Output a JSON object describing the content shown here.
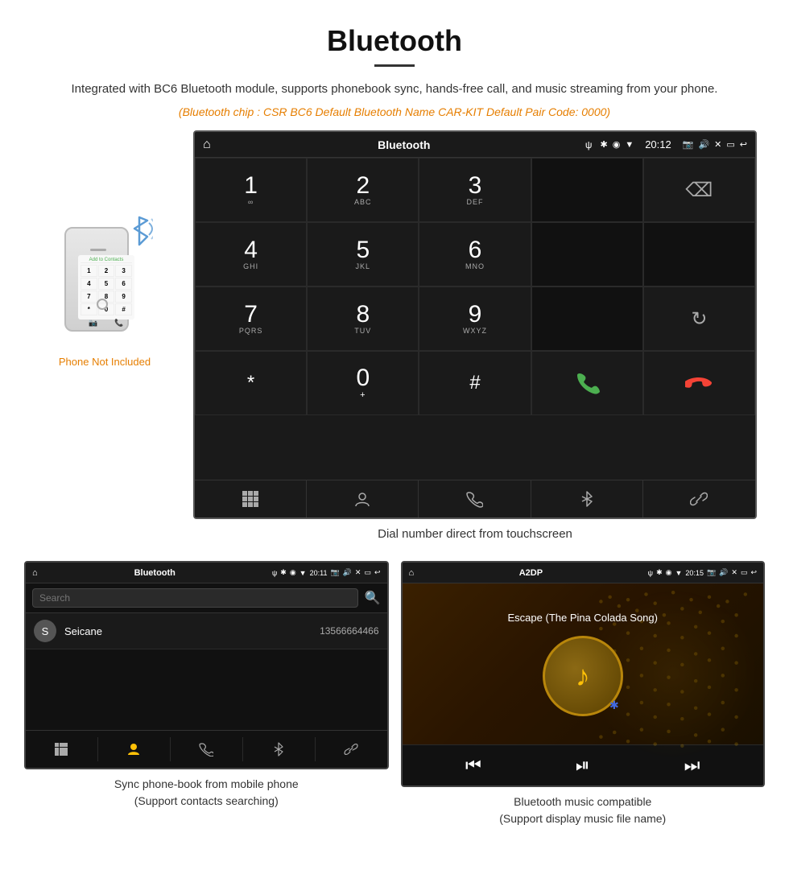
{
  "header": {
    "title": "Bluetooth",
    "description": "Integrated with BC6 Bluetooth module, supports phonebook sync, hands-free call, and music streaming from your phone.",
    "specs": "(Bluetooth chip : CSR BC6    Default Bluetooth Name CAR-KIT    Default Pair Code: 0000)"
  },
  "phone": {
    "not_included": "Phone Not Included",
    "screen_title": "Add to Contacts",
    "keys": [
      "1",
      "2",
      "3",
      "4",
      "5",
      "6",
      "7",
      "8",
      "9",
      "*",
      "0",
      "#"
    ]
  },
  "car_screen": {
    "status_bar": {
      "title": "Bluetooth",
      "usb": "ψ",
      "time": "20:12"
    },
    "dialer_keys": [
      {
        "num": "1",
        "sub": "∞"
      },
      {
        "num": "2",
        "sub": "ABC"
      },
      {
        "num": "3",
        "sub": "DEF"
      },
      {
        "num": "",
        "sub": ""
      },
      {
        "num": "⌫",
        "sub": ""
      },
      {
        "num": "4",
        "sub": "GHI"
      },
      {
        "num": "5",
        "sub": "JKL"
      },
      {
        "num": "6",
        "sub": "MNO"
      },
      {
        "num": "",
        "sub": ""
      },
      {
        "num": "",
        "sub": ""
      },
      {
        "num": "7",
        "sub": "PQRS"
      },
      {
        "num": "8",
        "sub": "TUV"
      },
      {
        "num": "9",
        "sub": "WXYZ"
      },
      {
        "num": "",
        "sub": ""
      },
      {
        "num": "↻",
        "sub": ""
      },
      {
        "num": "*",
        "sub": ""
      },
      {
        "num": "0",
        "sub": "+"
      },
      {
        "num": "#",
        "sub": ""
      },
      {
        "num": "📞",
        "sub": "green"
      },
      {
        "num": "📵",
        "sub": "red"
      }
    ],
    "bottom_bar": [
      "⊞",
      "👤",
      "📞",
      "✱",
      "🔗"
    ]
  },
  "dial_caption": "Dial number direct from touchscreen",
  "phonebook_screen": {
    "status_title": "Bluetooth",
    "time": "20:11",
    "search_placeholder": "Search",
    "contact": {
      "avatar": "S",
      "name": "Seicane",
      "phone": "13566664466"
    },
    "bottom_btns": [
      "⊞",
      "👤",
      "📞",
      "✱",
      "🔗"
    ]
  },
  "music_screen": {
    "status_title": "A2DP",
    "time": "20:15",
    "song_title": "Escape (The Pina Colada Song)"
  },
  "phonebook_caption_line1": "Sync phone-book from mobile phone",
  "phonebook_caption_line2": "(Support contacts searching)",
  "music_caption_line1": "Bluetooth music compatible",
  "music_caption_line2": "(Support display music file name)"
}
